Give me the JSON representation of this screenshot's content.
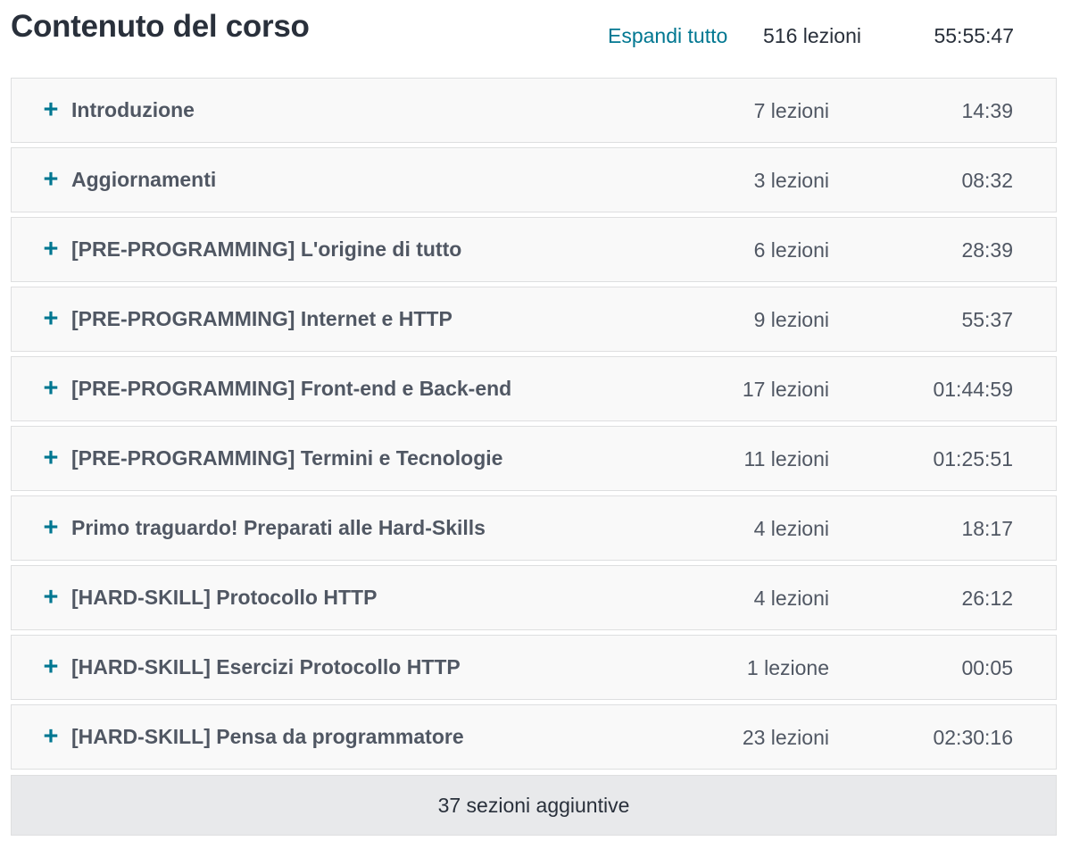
{
  "header": {
    "title": "Contenuto del corso",
    "expand_all": "Espandi tutto",
    "total_lectures": "516 lezioni",
    "total_duration": "55:55:47"
  },
  "colors": {
    "accent": "#007791",
    "section_bg": "#f9f9f9",
    "more_bg": "#e8e9eb",
    "border": "#dedfe0",
    "text": "#29303b",
    "muted_text": "#505763"
  },
  "sections": [
    {
      "icon": "plus-icon",
      "title": "Introduzione",
      "lectures": "7 lezioni",
      "duration": "14:39"
    },
    {
      "icon": "plus-icon",
      "title": "Aggiornamenti",
      "lectures": "3 lezioni",
      "duration": "08:32"
    },
    {
      "icon": "plus-icon",
      "title": "[PRE-PROGRAMMING] L'origine di tutto",
      "lectures": "6 lezioni",
      "duration": "28:39"
    },
    {
      "icon": "plus-icon",
      "title": "[PRE-PROGRAMMING] Internet e HTTP",
      "lectures": "9 lezioni",
      "duration": "55:37"
    },
    {
      "icon": "plus-icon",
      "title": "[PRE-PROGRAMMING] Front-end e Back-end",
      "lectures": "17 lezioni",
      "duration": "01:44:59"
    },
    {
      "icon": "plus-icon",
      "title": "[PRE-PROGRAMMING] Termini e Tecnologie",
      "lectures": "11 lezioni",
      "duration": "01:25:51"
    },
    {
      "icon": "plus-icon",
      "title": "Primo traguardo! Preparati alle Hard-Skills",
      "lectures": "4 lezioni",
      "duration": "18:17"
    },
    {
      "icon": "plus-icon",
      "title": "[HARD-SKILL] Protocollo HTTP",
      "lectures": "4 lezioni",
      "duration": "26:12"
    },
    {
      "icon": "plus-icon",
      "title": "[HARD-SKILL] Esercizi Protocollo HTTP",
      "lectures": "1 lezione",
      "duration": "00:05"
    },
    {
      "icon": "plus-icon",
      "title": "[HARD-SKILL] Pensa da programmatore",
      "lectures": "23 lezioni",
      "duration": "02:30:16"
    }
  ],
  "plus_glyph": "+",
  "more_sections": "37 sezioni aggiuntive"
}
